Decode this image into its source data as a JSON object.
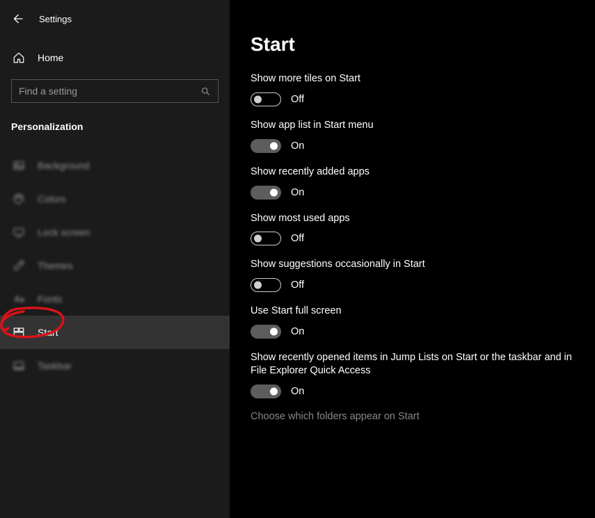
{
  "header": {
    "app_title": "Settings"
  },
  "sidebar": {
    "home_label": "Home",
    "search_placeholder": "Find a setting",
    "category_header": "Personalization",
    "items": [
      {
        "id": "background",
        "label": "Background",
        "icon": "picture-icon",
        "active": false,
        "blurred": true
      },
      {
        "id": "colors",
        "label": "Colors",
        "icon": "palette-icon",
        "active": false,
        "blurred": true
      },
      {
        "id": "lockscreen",
        "label": "Lock screen",
        "icon": "monitor-icon",
        "active": false,
        "blurred": true
      },
      {
        "id": "themes",
        "label": "Themes",
        "icon": "brush-icon",
        "active": false,
        "blurred": true
      },
      {
        "id": "fonts",
        "label": "Fonts",
        "icon": "fonts-icon",
        "active": false,
        "blurred": true
      },
      {
        "id": "start",
        "label": "Start",
        "icon": "start-icon",
        "active": true,
        "blurred": false
      },
      {
        "id": "taskbar",
        "label": "Taskbar",
        "icon": "taskbar-icon",
        "active": false,
        "blurred": true
      }
    ]
  },
  "main": {
    "title": "Start",
    "toggles": [
      {
        "label": "Show more tiles on Start",
        "state": "Off",
        "on": false
      },
      {
        "label": "Show app list in Start menu",
        "state": "On",
        "on": true
      },
      {
        "label": "Show recently added apps",
        "state": "On",
        "on": true
      },
      {
        "label": "Show most used apps",
        "state": "Off",
        "on": false
      },
      {
        "label": "Show suggestions occasionally in Start",
        "state": "Off",
        "on": false
      },
      {
        "label": "Use Start full screen",
        "state": "On",
        "on": true
      },
      {
        "label": "Show recently opened items in Jump Lists on Start or the taskbar and in File Explorer Quick Access",
        "state": "On",
        "on": true
      }
    ],
    "link": "Choose which folders appear on Start"
  }
}
